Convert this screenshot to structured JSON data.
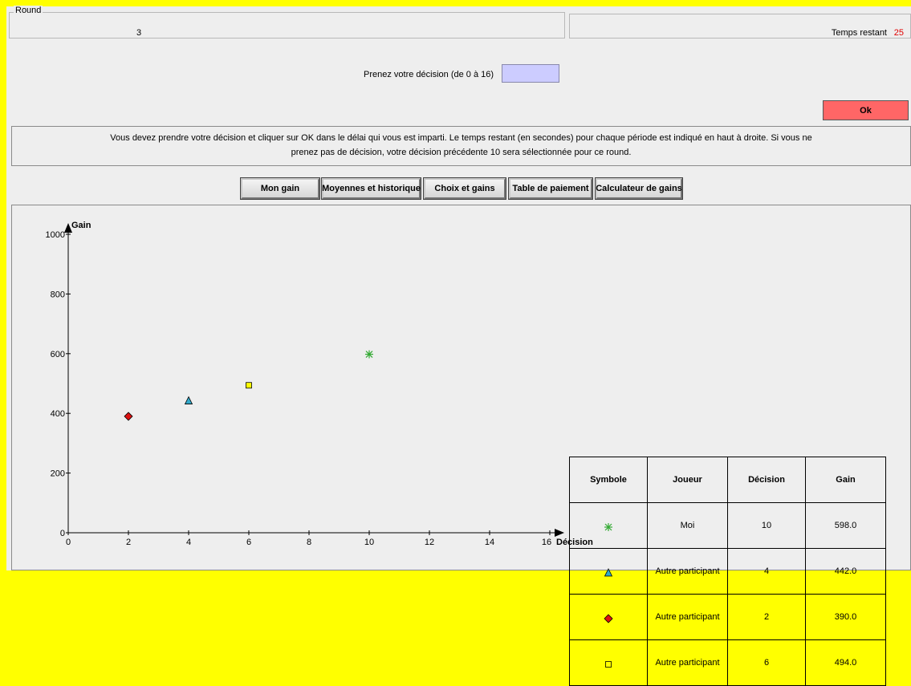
{
  "header": {
    "round_legend": "Round",
    "round_value": "3",
    "time_label": "Temps restant",
    "time_value": "25",
    "time_color": "#e00000"
  },
  "decision": {
    "label": "Prenez votre décision (de 0 à 16)",
    "input_value": "",
    "input_color": "#ccccff"
  },
  "ok_button": {
    "label": "Ok",
    "color": "#ff6666"
  },
  "instructions": {
    "line1": "Vous devez prendre votre décision et cliquer sur OK dans le délai qui vous est imparti. Le temps restant (en secondes) pour chaque période est indiqué en haut à droite. Si vous ne",
    "line2": "prenez pas de décision, votre décision précédente 10 sera sélectionnée pour ce round."
  },
  "tabs": [
    {
      "label": "Mon gain"
    },
    {
      "label": "Moyennes et historique"
    },
    {
      "label": "Choix et gains"
    },
    {
      "label": "Table de paiement"
    },
    {
      "label": "Calculateur de gains"
    }
  ],
  "chart_data": {
    "type": "scatter",
    "ylabel": "Gain",
    "xlabel": "Décision",
    "xlim": [
      0,
      16
    ],
    "ylim": [
      0,
      1000
    ],
    "x_ticks": [
      "0",
      "2",
      "4",
      "6",
      "8",
      "10",
      "12",
      "14",
      "16"
    ],
    "y_ticks": [
      "0",
      "200",
      "400",
      "600",
      "800",
      "1000"
    ],
    "points": [
      {
        "x": 10,
        "y": 598,
        "symbol": "asterisk",
        "color": "#33aa33"
      },
      {
        "x": 4,
        "y": 442,
        "symbol": "triangle",
        "color": "#33aacc"
      },
      {
        "x": 2,
        "y": 390,
        "symbol": "diamond",
        "color": "#dd1111"
      },
      {
        "x": 6,
        "y": 494,
        "symbol": "square",
        "color": "#ffff00"
      }
    ]
  },
  "table": {
    "headers": [
      "Symbole",
      "Joueur",
      "Décision",
      "Gain"
    ],
    "rows": [
      {
        "symbol": "asterisk",
        "joueur": "Moi",
        "decision": "10",
        "gain": "598.0"
      },
      {
        "symbol": "triangle",
        "joueur": "Autre participant",
        "decision": "4",
        "gain": "442.0"
      },
      {
        "symbol": "diamond",
        "joueur": "Autre participant",
        "decision": "2",
        "gain": "390.0"
      },
      {
        "symbol": "square",
        "joueur": "Autre participant",
        "decision": "6",
        "gain": "494.0"
      }
    ]
  }
}
